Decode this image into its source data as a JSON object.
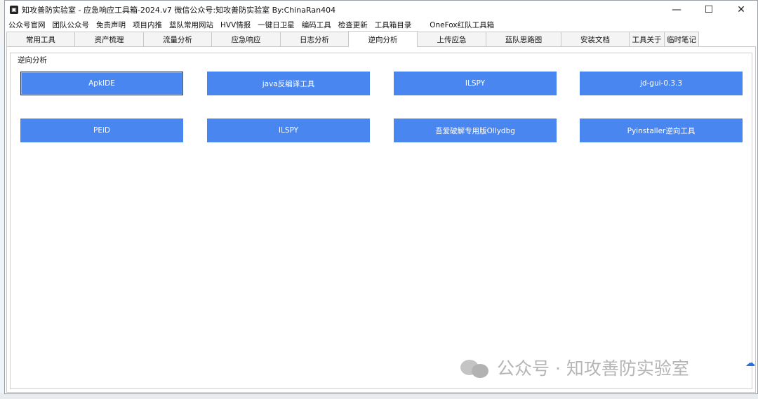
{
  "window": {
    "title": "知攻善防实验室 - 应急响应工具箱-2024.v7     微信公众号:知攻善防实验室    By:ChinaRan404",
    "icon": "toolbox-icon",
    "controls": {
      "minimize": "—",
      "maximize": "☐",
      "close": "✕"
    }
  },
  "menu": [
    "公众号官网",
    "团队公众号",
    "免责声明",
    "项目内推",
    "蓝队常用网站",
    "HVV情报",
    "一键日卫星",
    "编码工具",
    "检查更新",
    "工具箱目录",
    "OneFox红队工具箱"
  ],
  "tabs": [
    {
      "label": "常用工具"
    },
    {
      "label": "资产梳理"
    },
    {
      "label": "流量分析"
    },
    {
      "label": "应急响应"
    },
    {
      "label": "日志分析"
    },
    {
      "label": "逆向分析",
      "active": true
    },
    {
      "label": "上传应急"
    },
    {
      "label": "蓝队思路图"
    },
    {
      "label": "安装文档"
    },
    {
      "label": "工具关于"
    },
    {
      "label": "临时笔记"
    }
  ],
  "group": {
    "label": "逆向分析"
  },
  "tools": [
    "ApkIDE",
    "java反编译工具",
    "ILSPY",
    "jd-gui-0.3.3",
    "PEiD",
    "ILSPY",
    "吾爱破解专用版Ollydbg",
    "Pyinstaller逆向工具"
  ],
  "colors": {
    "button": "#4a86f0",
    "button_text": "#ffffff"
  },
  "watermark": {
    "text": "公众号 · 知攻善防实验室"
  }
}
